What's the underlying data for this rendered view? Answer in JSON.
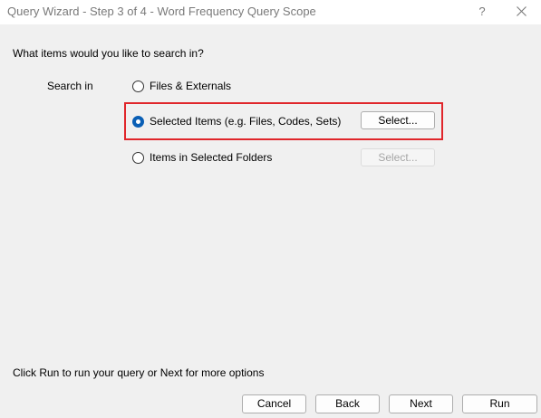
{
  "window": {
    "title": "Query Wizard - Step 3 of 4 - Word Frequency Query Scope",
    "help_label": "?"
  },
  "main": {
    "prompt": "What items would you like to search in?",
    "search_in_label": "Search in",
    "options": [
      {
        "label": "Files & Externals",
        "selected": false
      },
      {
        "label": "Selected Items (e.g. Files, Codes, Sets)",
        "selected": true
      },
      {
        "label": "Items in Selected Folders",
        "selected": false
      }
    ],
    "select_button_label": "Select...",
    "select_folders_button_label": "Select...",
    "highlight_color": "#e0262b"
  },
  "footer": {
    "note": "Click Run to run your query or Next for more options",
    "cancel_label": "Cancel",
    "back_label": "Back",
    "next_label": "Next",
    "run_label": "Run"
  },
  "colors": {
    "accent": "#0a5fb5",
    "background": "#f0f0f0",
    "title_text": "#7a7a7a"
  }
}
